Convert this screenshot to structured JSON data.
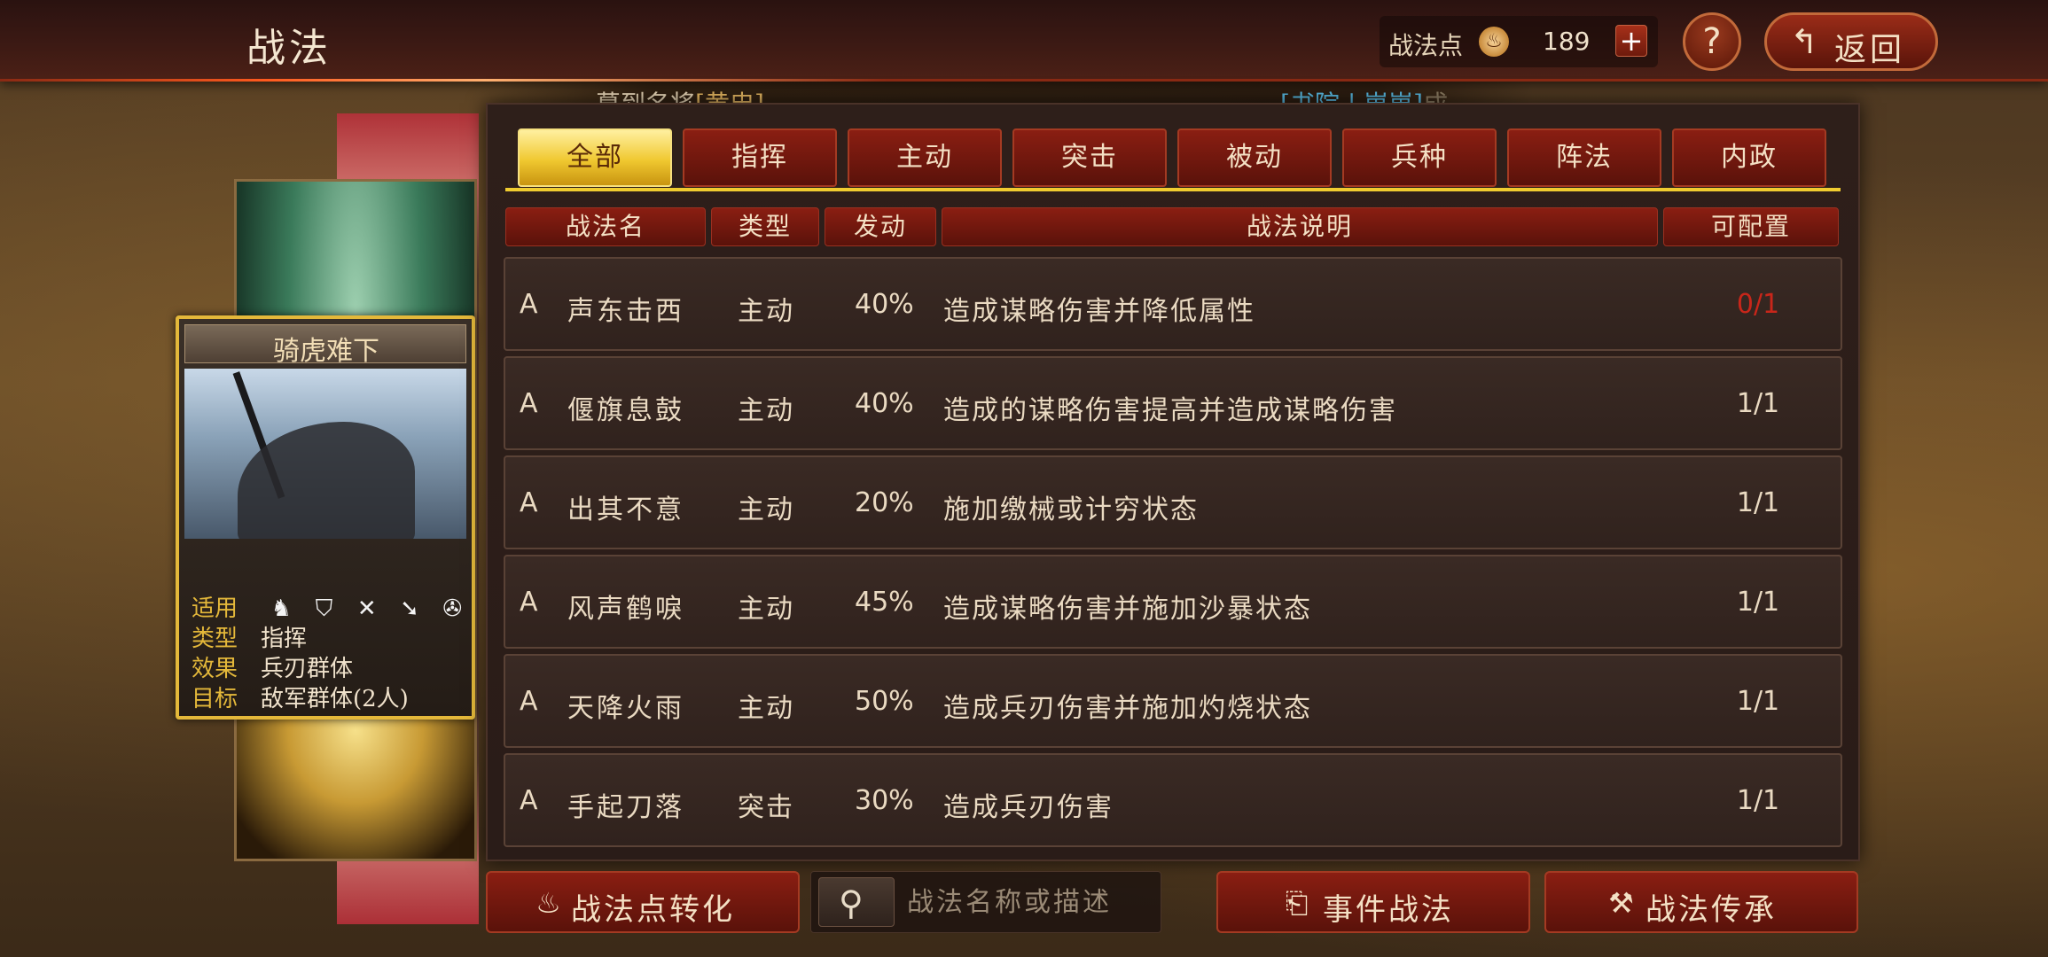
{
  "header": {
    "title": "战法",
    "points_label": "战法点",
    "points_value": "189",
    "plus_label": "+",
    "help_label": "?",
    "back_label": "返回"
  },
  "marquee": {
    "part1_prefix": "募到名将",
    "part1_highlight": "[黄忠]",
    "part2_link": "[书院 | 崽崽]",
    "part2_suffix": "成"
  },
  "card": {
    "title": "骑虎难下",
    "rows": [
      {
        "key": "适用",
        "value": ""
      },
      {
        "key": "类型",
        "value": "指挥"
      },
      {
        "key": "效果",
        "value": "兵刃群体"
      },
      {
        "key": "目标",
        "value": "敌军群体(2人)"
      }
    ],
    "unit_icons": [
      "cavalry-icon",
      "shield-icon",
      "bow-icon",
      "spear-icon",
      "siege-icon"
    ]
  },
  "tabs": [
    {
      "label": "全部",
      "active": true
    },
    {
      "label": "指挥"
    },
    {
      "label": "主动"
    },
    {
      "label": "突击"
    },
    {
      "label": "被动"
    },
    {
      "label": "兵种"
    },
    {
      "label": "阵法"
    },
    {
      "label": "内政"
    }
  ],
  "columns": {
    "name": "战法名",
    "type": "类型",
    "rate": "发动",
    "desc": "战法说明",
    "cfg": "可配置"
  },
  "rows": [
    {
      "grade": "A",
      "name": "声东击西",
      "type": "主动",
      "rate": "40%",
      "desc": "造成谋略伤害并降低属性",
      "cfg": "0/1",
      "warn": true
    },
    {
      "grade": "A",
      "name": "偃旗息鼓",
      "type": "主动",
      "rate": "40%",
      "desc": "造成的谋略伤害提高并造成谋略伤害",
      "cfg": "1/1"
    },
    {
      "grade": "A",
      "name": "出其不意",
      "type": "主动",
      "rate": "20%",
      "desc": "施加缴械或计穷状态",
      "cfg": "1/1"
    },
    {
      "grade": "A",
      "name": "风声鹤唳",
      "type": "主动",
      "rate": "45%",
      "desc": "造成谋略伤害并施加沙暴状态",
      "cfg": "1/1"
    },
    {
      "grade": "A",
      "name": "天降火雨",
      "type": "主动",
      "rate": "50%",
      "desc": "造成兵刃伤害并施加灼烧状态",
      "cfg": "1/1"
    },
    {
      "grade": "A",
      "name": "手起刀落",
      "type": "突击",
      "rate": "30%",
      "desc": "造成兵刃伤害",
      "cfg": "1/1"
    }
  ],
  "bottom": {
    "convert_label": "战法点转化",
    "search_placeholder": "战法名称或描述",
    "event_label": "事件战法",
    "inherit_label": "战法传承"
  },
  "colors": {
    "accent_gold": "#f0cc30",
    "button_red": "#8a1e12",
    "warn_red": "#c8261a"
  }
}
